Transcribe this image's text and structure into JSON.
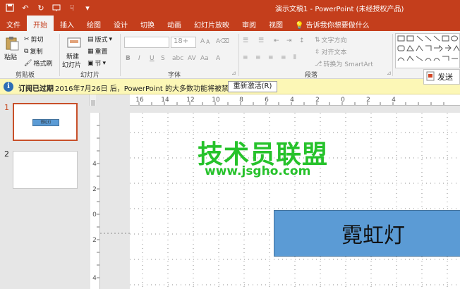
{
  "window": {
    "title": "演示文稿1 - PowerPoint (未经授权产品)"
  },
  "tabs": [
    {
      "label": "文件"
    },
    {
      "label": "开始"
    },
    {
      "label": "插入"
    },
    {
      "label": "绘图"
    },
    {
      "label": "设计"
    },
    {
      "label": "切换"
    },
    {
      "label": "动画"
    },
    {
      "label": "幻灯片放映"
    },
    {
      "label": "审阅"
    },
    {
      "label": "视图"
    },
    {
      "label": "告诉我你想要做什么"
    }
  ],
  "ribbon": {
    "clipboard": {
      "paste": "粘贴",
      "cut": "剪切",
      "copy": "复制",
      "format_painter": "格式刷",
      "label": "剪贴板"
    },
    "slides": {
      "new_slide_1": "新建",
      "new_slide_2": "幻灯片",
      "layout": "版式",
      "reset": "重置",
      "section": "节",
      "label": "幻灯片"
    },
    "font": {
      "size": "18+",
      "label": "字体"
    },
    "paragraph": {
      "text_direction": "文字方向",
      "align_text": "对齐文本",
      "smartart": "转换为 SmartArt",
      "label": "段落"
    },
    "send_label": "发送"
  },
  "message_bar": {
    "title": "订阅已过期",
    "text": "2016年7月26日 后，PowerPoint 的大多数功能将被禁用。",
    "button": "重新激活(R)"
  },
  "thumbnails": [
    {
      "number": "1",
      "shape_text": "霓虹灯"
    },
    {
      "number": "2"
    }
  ],
  "ruler": {
    "h_labels": [
      "16",
      "14",
      "12",
      "10",
      "8",
      "6",
      "4",
      "2",
      "0",
      "2",
      "4"
    ],
    "v_labels": [
      "4",
      "2",
      "0",
      "2",
      "4"
    ]
  },
  "slide": {
    "shape_text": "霓虹灯"
  },
  "watermark": {
    "brand": "技术员联盟",
    "url": "www.jsgho.com"
  }
}
